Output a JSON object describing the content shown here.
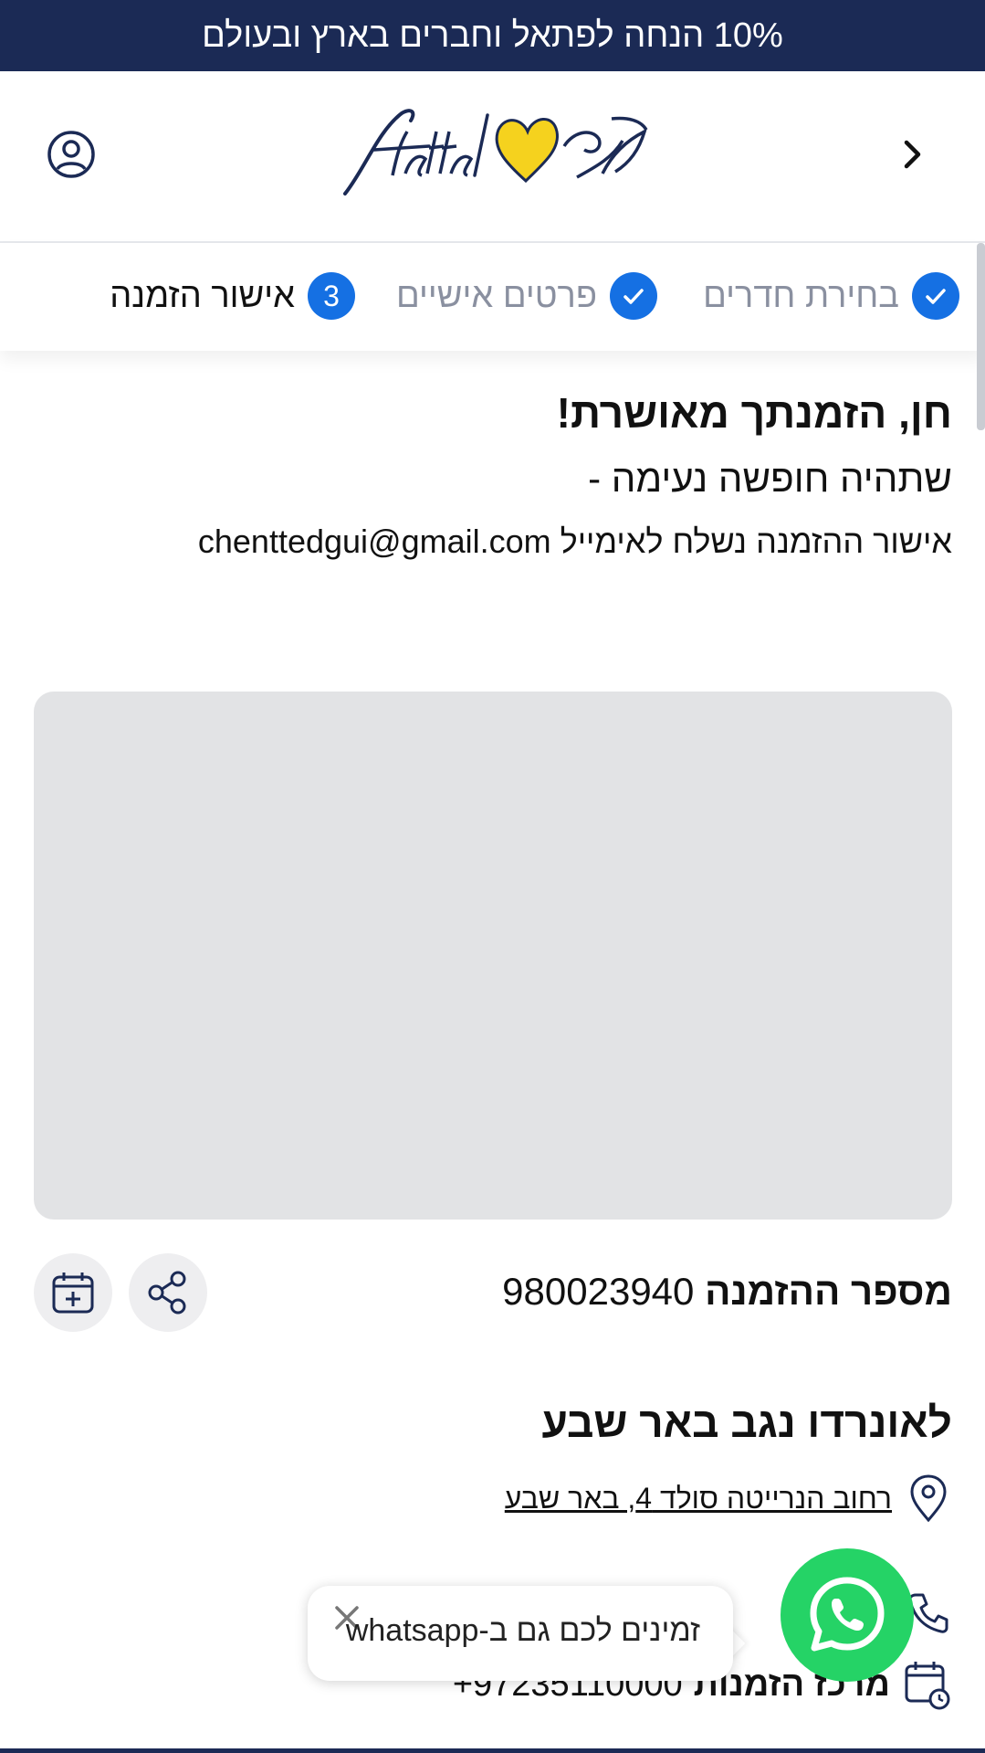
{
  "promo_banner": {
    "text": "10% הנחה לפתאל וחברים בארץ ובעולם"
  },
  "header": {
    "logo_alt": "fattal פתאל",
    "back_icon": "chevron-right-icon",
    "user_icon": "user-circle-icon"
  },
  "steps": [
    {
      "label": "בחירת חדרים",
      "state": "done"
    },
    {
      "label": "פרטים אישיים",
      "state": "done"
    },
    {
      "label": "אישור הזמנה",
      "number": "3",
      "state": "active"
    }
  ],
  "confirmation": {
    "title": "חן, הזמנתך מאושרת!",
    "subtitle": "שתהיה חופשה נעימה -",
    "email_text": "אישור ההזמנה נשלח לאימייל chenttedgui@gmail.com"
  },
  "booking": {
    "label": "מספר ההזמנה",
    "number": "980023940",
    "share_icon": "share-icon",
    "calendar_icon": "calendar-add-icon"
  },
  "hotel": {
    "name": "לאונרדו נגב באר שבע",
    "address": "רחוב הנרייטה סולד 4, באר שבע",
    "phone_label": "במ",
    "center_label": "מרכז הזמנות",
    "center_phone": "+97235110000"
  },
  "whatsapp": {
    "bubble_text": "זמינים לכם גם ב-whatsapp",
    "brand_color": "#25d366"
  },
  "colors": {
    "navy": "#1b2a55",
    "accent_blue": "#1570e3",
    "logo_yellow": "#f5d21e"
  }
}
